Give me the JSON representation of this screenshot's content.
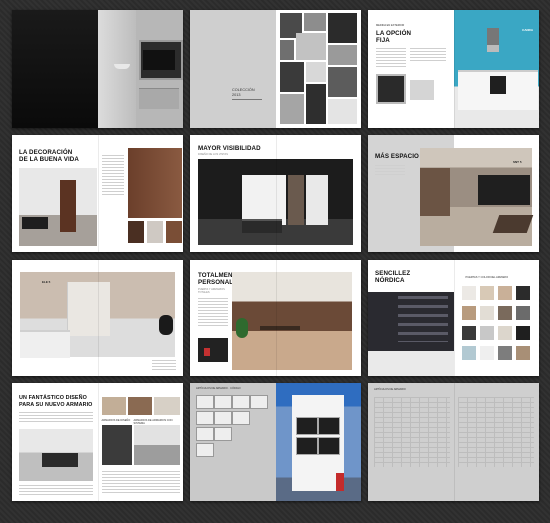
{
  "spreads": [
    {
      "cover_title_1": "COLECCIÓN",
      "cover_title_2": "2013"
    },
    {
      "title_line1": "LA OPCIÓN",
      "title_line2": "FIJA",
      "small_label": "MEDIDA EN EXTERIOR",
      "box_label": "CANDA"
    },
    {
      "title_line1": "LA DECORACIÓN",
      "title_line2": "DE LA BUENA VIDA"
    },
    {
      "title": "MAYOR VISIBILIDAD",
      "subtitle": "DISEÑO DE LOS VISTAS"
    },
    {
      "title": "MÁS ESPACIO",
      "badge": "SNT 5"
    },
    {
      "badge": "ELE 5"
    },
    {
      "title_line1": "TOTALMENTE",
      "title_line2": "PERSONALIZADO",
      "sub_1": "PUERTA Y ARMARIOS",
      "sub_2": "TOTALES"
    },
    {
      "title_line1": "SENCILLEZ",
      "title_line2": "NÓRDICA",
      "swatch_header": "PUERTAS Y COLOR DEL ARMARIO"
    },
    {
      "title_line1": "UN FANTÁSTICO DISEÑO",
      "title_line2": "PARA SU NUEVO ARMARIO",
      "caption_1": "ARMARIOS DE DISEÑO",
      "caption_2": "ARMARIOS DE ARMARIOS CON SISTEMA"
    },
    {
      "header": "ARTÍCULOS DE ARMARIO · CÓDIGO"
    },
    {
      "header": "ARTÍCULOS DE ARMARIO"
    }
  ]
}
